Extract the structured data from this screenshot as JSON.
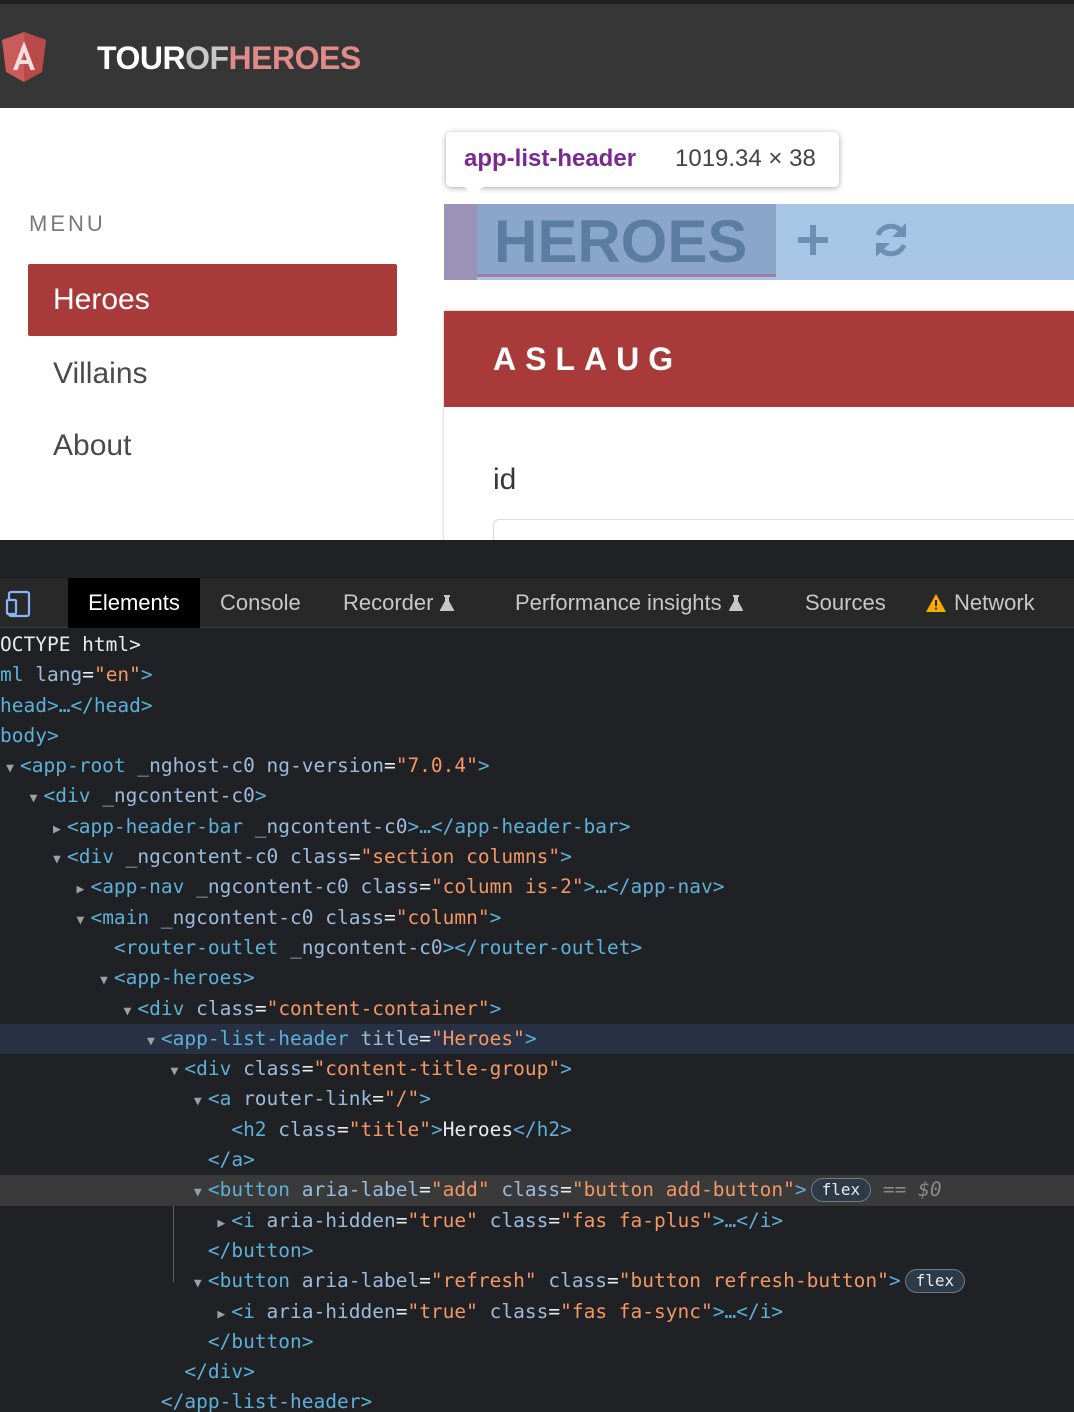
{
  "app": {
    "brand": {
      "part1": "TOUR",
      "part2": "OF",
      "part3": "HEROES"
    },
    "menu_label": "MENU",
    "nav": [
      {
        "label": "Heroes",
        "active": true
      },
      {
        "label": "Villains",
        "active": false
      },
      {
        "label": "About",
        "active": false
      }
    ],
    "list_header": {
      "title": "HEROES",
      "add_icon": "plus-icon",
      "refresh_icon": "sync-icon"
    },
    "tooltip": {
      "name": "app-list-header",
      "size": "1019.34 × 38"
    },
    "card": {
      "name": "ASLAUG",
      "field_label": "id",
      "field_value": ""
    },
    "colors": {
      "header_bg": "#363636",
      "accent": "#a93a3a",
      "highlight": "#a7c6e5"
    }
  },
  "devtools": {
    "tabs": [
      {
        "label": "Elements",
        "active": true
      },
      {
        "label": "Console",
        "active": false
      },
      {
        "label": "Recorder",
        "active": false
      },
      {
        "label": "Performance insights",
        "active": false
      },
      {
        "label": "Sources",
        "active": false
      },
      {
        "label": "Network",
        "active": false
      }
    ],
    "tree": {
      "r0": "OCTYPE html>",
      "r1_tag": "ml",
      "r1_attr": "lang",
      "r1_val": "\"en\"",
      "r2": "head>…</head>",
      "r3": "body>",
      "r4_tag": "<app-root",
      "r4_attr": " _nghost-c0 ng-version",
      "r4_val": "\"7.0.4\"",
      "r5_tag": "<div",
      "r5_attr": " _ngcontent-c0",
      "r6_tag": "<app-header-bar",
      "r6_attr": " _ngcontent-c0",
      "r6_end": ">…</app-header-bar>",
      "r7_tag": "<div",
      "r7_attr": " _ngcontent-c0 class",
      "r7_val": "\"section columns\"",
      "r8_tag": "<app-nav",
      "r8_attr": " _ngcontent-c0 class",
      "r8_val": "\"column is-2\"",
      "r8_end": ">…</app-nav>",
      "r9_tag": "<main",
      "r9_attr": " _ngcontent-c0 class",
      "r9_val": "\"column\"",
      "r10_tag": "<router-outlet",
      "r10_attr": " _ngcontent-c0",
      "r10_end": "></router-outlet>",
      "r11_tag": "<app-heroes>",
      "r12_tag": "<div",
      "r12_attr": " class",
      "r12_val": "\"content-container\"",
      "r13_tag": "<app-list-header",
      "r13_attr": " title",
      "r13_val": "\"Heroes\"",
      "r14_tag": "<div",
      "r14_attr": " class",
      "r14_val": "\"content-title-group\"",
      "r15_tag": "<a",
      "r15_attr": " router-link",
      "r15_val": "\"/\"",
      "r16_tag": "<h2",
      "r16_attr": " class",
      "r16_val": "\"title\"",
      "r16_text": "Heroes",
      "r16_end": "</h2>",
      "r17": "</a>",
      "r18_tag": "<button",
      "r18_attr": " aria-label",
      "r18_val": "\"add\"",
      "r18_attr2": " class",
      "r18_val2": "\"button add-button\"",
      "r18_badge": "flex",
      "r18_eq": "== $0",
      "r19_tag": "<i",
      "r19_attr": " aria-hidden",
      "r19_val": "\"true\"",
      "r19_attr2": " class",
      "r19_val2": "\"fas fa-plus\"",
      "r19_end": ">…</i>",
      "r20": "</button>",
      "r21_tag": "<button",
      "r21_attr": " aria-label",
      "r21_val": "\"refresh\"",
      "r21_attr2": " class",
      "r21_val2": "\"button refresh-button\"",
      "r21_badge": "flex",
      "r22_tag": "<i",
      "r22_attr": " aria-hidden",
      "r22_val": "\"true\"",
      "r22_attr2": " class",
      "r22_val2": "\"fas fa-sync\"",
      "r22_end": ">…</i>",
      "r23": "</button>",
      "r24": "</div>",
      "r25": "</app-list-header>"
    }
  }
}
